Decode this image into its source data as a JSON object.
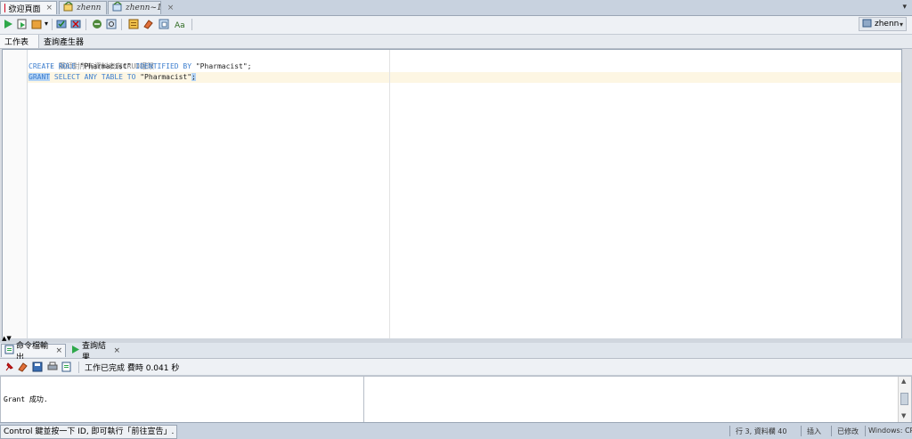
{
  "document_tabs": [
    {
      "label": "歡迎頁面",
      "close": "×"
    },
    {
      "label": "zhenn",
      "close": "×"
    },
    {
      "label": "zhenn~1",
      "close": "×"
    }
  ],
  "toolbar": {
    "connection": "zhenn"
  },
  "subtabs": [
    "工作表",
    "查詢產生器"
  ],
  "editor": {
    "line1": {
      "comment": "-- 藥師對所有資料表有CRUD權限"
    },
    "line2": {
      "kw1": "CREATE ROLE",
      "str1": " \"Pharmacist\" ",
      "kw2": "IDENTIFIED BY",
      "str2": " \"Pharmacist\";"
    },
    "line3": {
      "kw0": "GRANT",
      "kw1": " SELECT ANY TABLE TO",
      "str1": " \"Pharmacist\"",
      "semi": ";"
    }
  },
  "bottom_tabs": [
    {
      "label": "命令檔輸出",
      "close": "×"
    },
    {
      "label": "查詢結果",
      "close": "×"
    }
  ],
  "bottom_status": "工作已完成 費時 0.041 秒",
  "output_text": "Grant 成功.",
  "statusbar": {
    "hint": "Control 鍵並按一下 ID, 即可執行「前往宣告」.",
    "position": "行 3, 資料欄 40",
    "mode": "插入",
    "modified": "已修改",
    "line_ending": "Windows: CR"
  },
  "colors": {
    "keyword": "#3e7fcf",
    "comment": "#888888",
    "selection": "#b5d4f5",
    "current_line": "#fdf6e3"
  }
}
